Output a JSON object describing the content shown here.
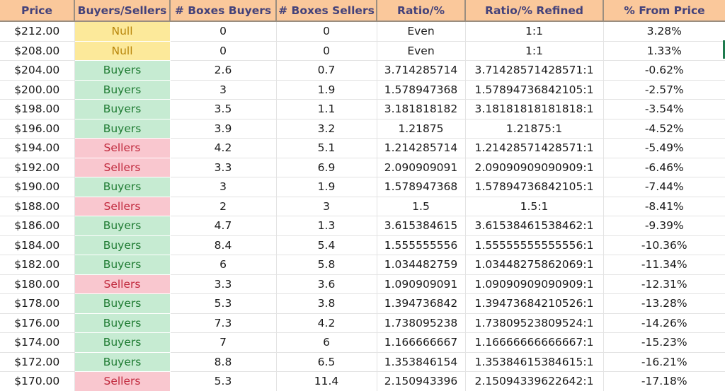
{
  "sheet": {
    "title": "Price Ladder Buyers/Sellers Ratio Table",
    "colors": {
      "header_bg": "#FAC89B",
      "header_text": "#44427A",
      "buyers_bg": "#C6EBD2",
      "buyers_text": "#1E7B32",
      "sellers_bg": "#F9C7CF",
      "sellers_text": "#C0283C",
      "null_bg": "#FCE99A",
      "null_text": "#B8860B",
      "gridline": "#E3E3E3",
      "cell_cursor": "#1E7B4E"
    }
  },
  "table": {
    "columns": [
      {
        "key": "price",
        "label": "Price"
      },
      {
        "key": "side",
        "label": "Buyers/Sellers"
      },
      {
        "key": "boxes_buyers",
        "label": "# Boxes Buyers"
      },
      {
        "key": "boxes_sellers",
        "label": "# Boxes Sellers"
      },
      {
        "key": "ratio",
        "label": "Ratio/%"
      },
      {
        "key": "refined",
        "label": "Ratio/% Refined"
      },
      {
        "key": "pct",
        "label": "% From Price"
      }
    ],
    "rows": [
      {
        "price": "$212.00",
        "side": "Null",
        "boxes_buyers": "0",
        "boxes_sellers": "0",
        "ratio": "Even",
        "refined": "1:1",
        "pct": "3.28%"
      },
      {
        "price": "$208.00",
        "side": "Null",
        "boxes_buyers": "0",
        "boxes_sellers": "0",
        "ratio": "Even",
        "refined": "1:1",
        "pct": "1.33%"
      },
      {
        "price": "$204.00",
        "side": "Buyers",
        "boxes_buyers": "2.6",
        "boxes_sellers": "0.7",
        "ratio": "3.714285714",
        "refined": "3.71428571428571:1",
        "pct": "-0.62%"
      },
      {
        "price": "$200.00",
        "side": "Buyers",
        "boxes_buyers": "3",
        "boxes_sellers": "1.9",
        "ratio": "1.578947368",
        "refined": "1.57894736842105:1",
        "pct": "-2.57%"
      },
      {
        "price": "$198.00",
        "side": "Buyers",
        "boxes_buyers": "3.5",
        "boxes_sellers": "1.1",
        "ratio": "3.181818182",
        "refined": "3.18181818181818:1",
        "pct": "-3.54%"
      },
      {
        "price": "$196.00",
        "side": "Buyers",
        "boxes_buyers": "3.9",
        "boxes_sellers": "3.2",
        "ratio": "1.21875",
        "refined": "1.21875:1",
        "pct": "-4.52%"
      },
      {
        "price": "$194.00",
        "side": "Sellers",
        "boxes_buyers": "4.2",
        "boxes_sellers": "5.1",
        "ratio": "1.214285714",
        "refined": "1.21428571428571:1",
        "pct": "-5.49%"
      },
      {
        "price": "$192.00",
        "side": "Sellers",
        "boxes_buyers": "3.3",
        "boxes_sellers": "6.9",
        "ratio": "2.090909091",
        "refined": "2.09090909090909:1",
        "pct": "-6.46%"
      },
      {
        "price": "$190.00",
        "side": "Buyers",
        "boxes_buyers": "3",
        "boxes_sellers": "1.9",
        "ratio": "1.578947368",
        "refined": "1.57894736842105:1",
        "pct": "-7.44%"
      },
      {
        "price": "$188.00",
        "side": "Sellers",
        "boxes_buyers": "2",
        "boxes_sellers": "3",
        "ratio": "1.5",
        "refined": "1.5:1",
        "pct": "-8.41%"
      },
      {
        "price": "$186.00",
        "side": "Buyers",
        "boxes_buyers": "4.7",
        "boxes_sellers": "1.3",
        "ratio": "3.615384615",
        "refined": "3.61538461538462:1",
        "pct": "-9.39%"
      },
      {
        "price": "$184.00",
        "side": "Buyers",
        "boxes_buyers": "8.4",
        "boxes_sellers": "5.4",
        "ratio": "1.555555556",
        "refined": "1.55555555555556:1",
        "pct": "-10.36%"
      },
      {
        "price": "$182.00",
        "side": "Buyers",
        "boxes_buyers": "6",
        "boxes_sellers": "5.8",
        "ratio": "1.034482759",
        "refined": "1.03448275862069:1",
        "pct": "-11.34%"
      },
      {
        "price": "$180.00",
        "side": "Sellers",
        "boxes_buyers": "3.3",
        "boxes_sellers": "3.6",
        "ratio": "1.090909091",
        "refined": "1.09090909090909:1",
        "pct": "-12.31%"
      },
      {
        "price": "$178.00",
        "side": "Buyers",
        "boxes_buyers": "5.3",
        "boxes_sellers": "3.8",
        "ratio": "1.394736842",
        "refined": "1.39473684210526:1",
        "pct": "-13.28%"
      },
      {
        "price": "$176.00",
        "side": "Buyers",
        "boxes_buyers": "7.3",
        "boxes_sellers": "4.2",
        "ratio": "1.738095238",
        "refined": "1.73809523809524:1",
        "pct": "-14.26%"
      },
      {
        "price": "$174.00",
        "side": "Buyers",
        "boxes_buyers": "7",
        "boxes_sellers": "6",
        "ratio": "1.166666667",
        "refined": "1.16666666666667:1",
        "pct": "-15.23%"
      },
      {
        "price": "$172.00",
        "side": "Buyers",
        "boxes_buyers": "8.8",
        "boxes_sellers": "6.5",
        "ratio": "1.353846154",
        "refined": "1.35384615384615:1",
        "pct": "-16.21%"
      },
      {
        "price": "$170.00",
        "side": "Sellers",
        "boxes_buyers": "5.3",
        "boxes_sellers": "11.4",
        "ratio": "2.150943396",
        "refined": "2.15094339622642:1",
        "pct": "-17.18%"
      }
    ]
  },
  "selection": {
    "cursor_row_index": 1,
    "cursor_edge": "right"
  }
}
